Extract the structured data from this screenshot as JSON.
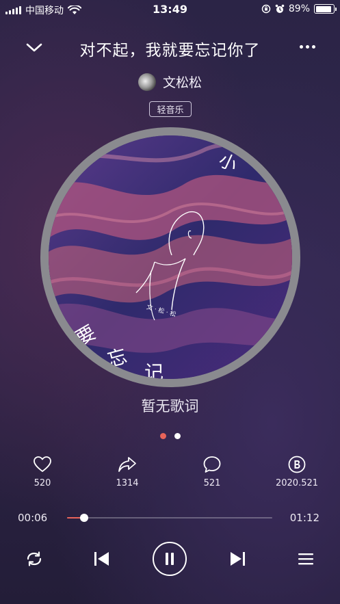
{
  "status_bar": {
    "carrier": "中国移动",
    "time": "13:49",
    "battery_text": "89%",
    "battery_level": 0.89
  },
  "header": {
    "title": "对不起，我就要忘记你了"
  },
  "artist": {
    "name": "文松松"
  },
  "tag": "轻音乐",
  "lyrics": "暂无歌词",
  "page_dots": {
    "count": 2,
    "active_index": 0,
    "active_color": "#e8645a",
    "inactive_color": "#ffffff"
  },
  "actions": [
    {
      "icon": "heart-icon",
      "count": "520"
    },
    {
      "icon": "share-icon",
      "count": "1314"
    },
    {
      "icon": "comment-icon",
      "count": "521"
    },
    {
      "icon": "b-coin-icon",
      "count": "2020.521"
    }
  ],
  "player": {
    "current_time": "00:06",
    "total_time": "01:12",
    "progress": 0.083,
    "accent": "#e8645a"
  },
  "cover_text": {
    "artist_line": "文 · 松 · 松",
    "corner_glyph": "小",
    "bottom_glyphs": [
      "要",
      "忘",
      "记"
    ]
  },
  "controls": [
    {
      "icon": "repeat-icon"
    },
    {
      "icon": "previous-icon"
    },
    {
      "icon": "pause-icon"
    },
    {
      "icon": "next-icon"
    },
    {
      "icon": "playlist-icon"
    }
  ]
}
